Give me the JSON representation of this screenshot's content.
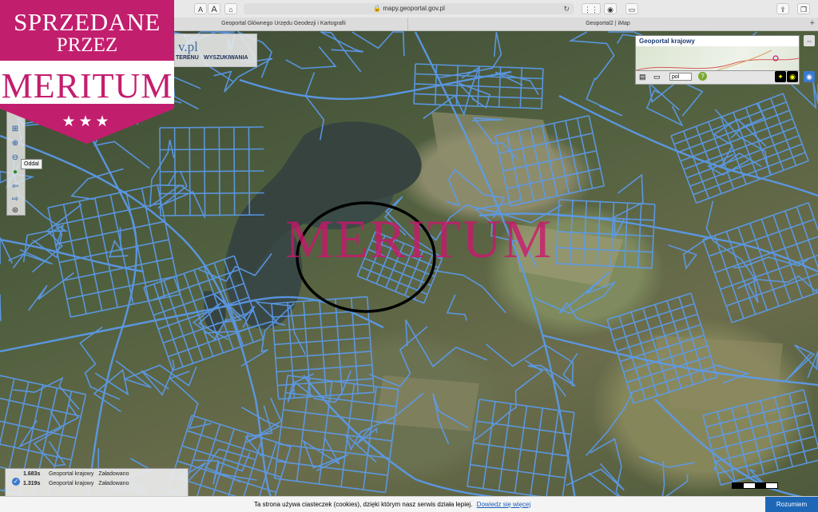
{
  "browser": {
    "url": "mapy.geoportal.gov.pl",
    "font_small": "A",
    "font_large": "A",
    "tabs": [
      {
        "label": "Geoportal Głównego Urzędu Geodezji i Kartografii"
      },
      {
        "label": "Geoportal2 | iMap"
      }
    ]
  },
  "ribbon": {
    "line1": "SPRZEDANE",
    "line2": "PRZEZ",
    "line3": "MERITUM",
    "stars": "★★★",
    "color": "#c21e6e"
  },
  "header": {
    "logo_fragment": "v.pl",
    "menu_items": [
      {
        "label": "TERENU"
      },
      {
        "label": "WYSZUKIWANIA"
      }
    ]
  },
  "toolbar": {
    "tooltip": "Oddal"
  },
  "overview": {
    "title": "Geoportal krajowy",
    "language": "pol"
  },
  "watermark": "MERITUM",
  "status": {
    "rows": [
      {
        "time": "1.683s",
        "source": "Geoportal krajowy",
        "state": "Załadowano"
      },
      {
        "time": "1.319s",
        "source": "Geoportal krajowy",
        "state": "Załadowano"
      }
    ]
  },
  "cookie": {
    "text": "Ta strona używa ciasteczek (cookies), dzięki którym nasz serwis działa lepiej.",
    "link": "Dowiedz się więcej",
    "accept": "Rozumiem"
  },
  "colors": {
    "parcel_lines": "#5b9cf0",
    "lake": "#36433f",
    "circle": "#000000"
  }
}
